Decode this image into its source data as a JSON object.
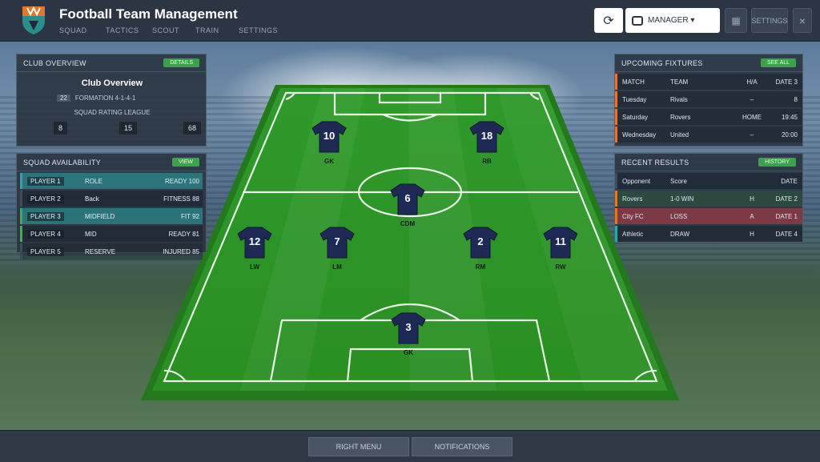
{
  "app": {
    "title": "Football Team Management",
    "nav": [
      "SQUAD",
      "TACTICS",
      "SCOUT",
      "TRAIN",
      "SETTINGS"
    ]
  },
  "toolbar": {
    "refresh_icon": "refresh-icon",
    "manager_label": "MANAGER ▾",
    "grid_icon": "grid-icon",
    "settings_label": "SETTINGS",
    "close_icon": "×"
  },
  "club_panel": {
    "title": "CLUB OVERVIEW",
    "pill": "DETAILS",
    "name": "Club Overview",
    "sub_tag": "22",
    "sub_text": "FORMATION 4-1-4-1",
    "desc": "SQUAD RATING LEAGUE",
    "stats": [
      "8",
      "15",
      "68"
    ]
  },
  "squad_panel": {
    "title": "SQUAD AVAILABILITY",
    "pill": "VIEW",
    "rows": [
      {
        "c1": "PLAYER 1",
        "c2": "ROLE",
        "c3": "READY 100",
        "accent": "#2aa6a6",
        "bg": "rgba(42,166,166,0.55)"
      },
      {
        "c1": "PLAYER 2",
        "c2": "Back",
        "c3": "FITNESS 88",
        "accent": "#3d4b5a",
        "bg": "rgba(25,35,45,0.55)"
      },
      {
        "c1": "PLAYER 3",
        "c2": "MIDFIELD",
        "c3": "FIT 92",
        "accent": "#37b34a",
        "bg": "rgba(42,166,166,0.55)"
      },
      {
        "c1": "PLAYER 4",
        "c2": "MID",
        "c3": "READY 81",
        "accent": "#37b34a",
        "bg": "rgba(25,35,45,0.55)"
      },
      {
        "c1": "PLAYER 5",
        "c2": "RESERVE",
        "c3": "INJURED 85",
        "accent": "#3d4b5a",
        "bg": "rgba(25,35,45,0.45)"
      }
    ]
  },
  "fixtures_panel": {
    "title": "UPCOMING FIXTURES",
    "pill": "SEE ALL",
    "rows": [
      {
        "c1": "MATCH",
        "c2": "TEAM",
        "c3": "H/A",
        "c4": "DATE 3",
        "accent": "#e6742b",
        "bg": "rgba(25,35,45,0.55)"
      },
      {
        "c1": "Tuesday",
        "c2": "Rivals",
        "c3": "–",
        "c4": "8",
        "accent": "#e6742b",
        "bg": "rgba(25,35,45,0.55)"
      },
      {
        "c1": "Saturday",
        "c2": "Rovers",
        "c3": "HOME",
        "c4": "19:45",
        "accent": "#e6742b",
        "bg": "rgba(25,35,45,0.55)"
      },
      {
        "c1": "Wednesday",
        "c2": "United",
        "c3": "–",
        "c4": "20:00",
        "accent": "#e6742b",
        "bg": "rgba(25,35,45,0.55)"
      }
    ]
  },
  "results_panel": {
    "title": "RECENT RESULTS",
    "pill": "HISTORY",
    "rows": [
      {
        "c1": "Opponent",
        "c2": "Score",
        "c3": "",
        "c4": "DATE",
        "accent": "#3d4b5a",
        "bg": "rgba(25,35,45,0.55)"
      },
      {
        "c1": "Rovers",
        "c2": "1-0 WIN",
        "c3": "H",
        "c4": "DATE 2",
        "accent": "#e6742b",
        "bg": "rgba(46,90,60,0.55)"
      },
      {
        "c1": "City FC",
        "c2": "LOSS",
        "c3": "A",
        "c4": "DATE 1",
        "accent": "#e6742b",
        "bg": "rgba(180,60,70,0.6)"
      },
      {
        "c1": "Athletic",
        "c2": "DRAW",
        "c3": "H",
        "c4": "DATE 4",
        "accent": "#2aa6a6",
        "bg": "rgba(25,35,45,0.55)"
      }
    ]
  },
  "pitch": {
    "players": [
      {
        "num": "10",
        "name": "GK"
      },
      {
        "num": "18",
        "name": "RB"
      },
      {
        "num": "6",
        "name": "CDM"
      },
      {
        "num": "12",
        "name": "LW"
      },
      {
        "num": "7",
        "name": "LM"
      },
      {
        "num": "2",
        "name": "RM"
      },
      {
        "num": "11",
        "name": "RW"
      },
      {
        "num": "3",
        "name": "GK"
      }
    ]
  },
  "bottom": {
    "left_label": "RIGHT MENU",
    "right_label": "NOTIFICATIONS"
  }
}
